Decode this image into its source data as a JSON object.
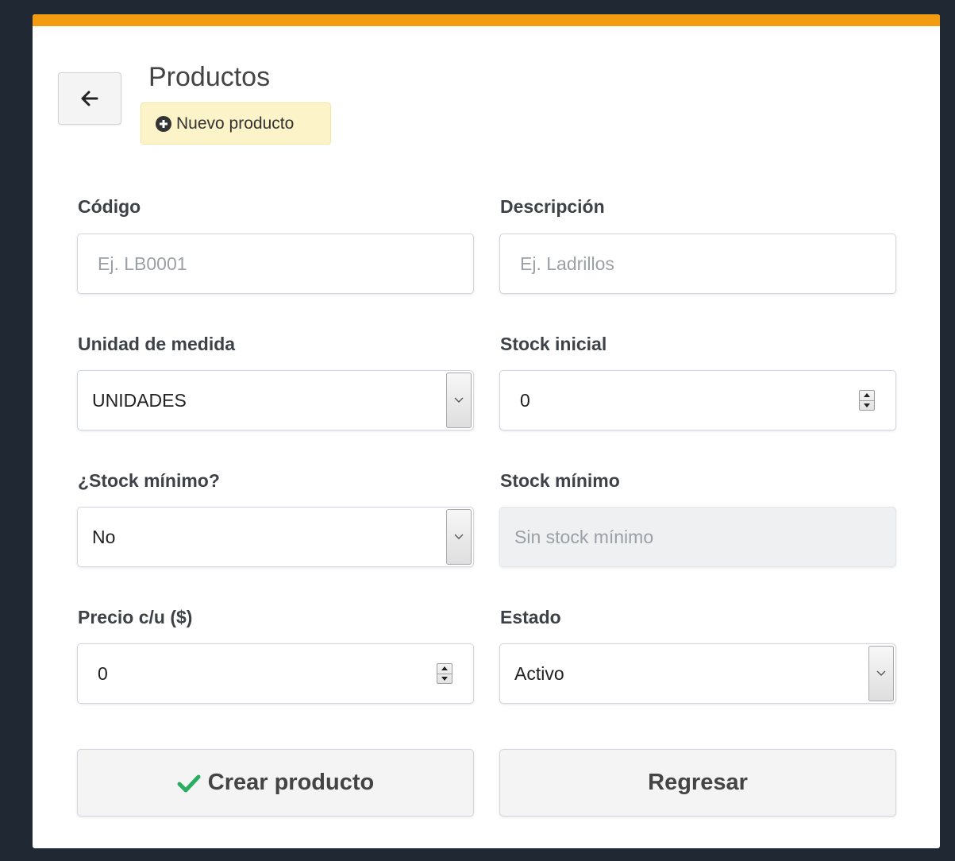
{
  "header": {
    "title": "Productos",
    "badge_label": "Nuevo producto",
    "back_icon": "arrow-left-icon",
    "badge_icon": "plus-circle-icon",
    "accent_color": "#f39c12",
    "badge_color": "#fdf3c8"
  },
  "form": {
    "codigo": {
      "label": "Código",
      "placeholder": "Ej. LB0001",
      "value": ""
    },
    "descripcion": {
      "label": "Descripción",
      "placeholder": "Ej. Ladrillos",
      "value": ""
    },
    "unidad": {
      "label": "Unidad de medida",
      "value": "UNIDADES"
    },
    "stock_inicial": {
      "label": "Stock inicial",
      "value": "0"
    },
    "stock_minimo_toggle": {
      "label": "¿Stock mínimo?",
      "value": "No"
    },
    "stock_minimo": {
      "label": "Stock mínimo",
      "placeholder": "Sin stock mínimo",
      "value": ""
    },
    "precio": {
      "label": "Precio c/u ($)",
      "value": "0"
    },
    "estado": {
      "label": "Estado",
      "value": "Activo"
    }
  },
  "actions": {
    "create_label": "Crear producto",
    "create_icon": "check-icon",
    "check_color": "#27ae60",
    "back_label": "Regresar"
  }
}
